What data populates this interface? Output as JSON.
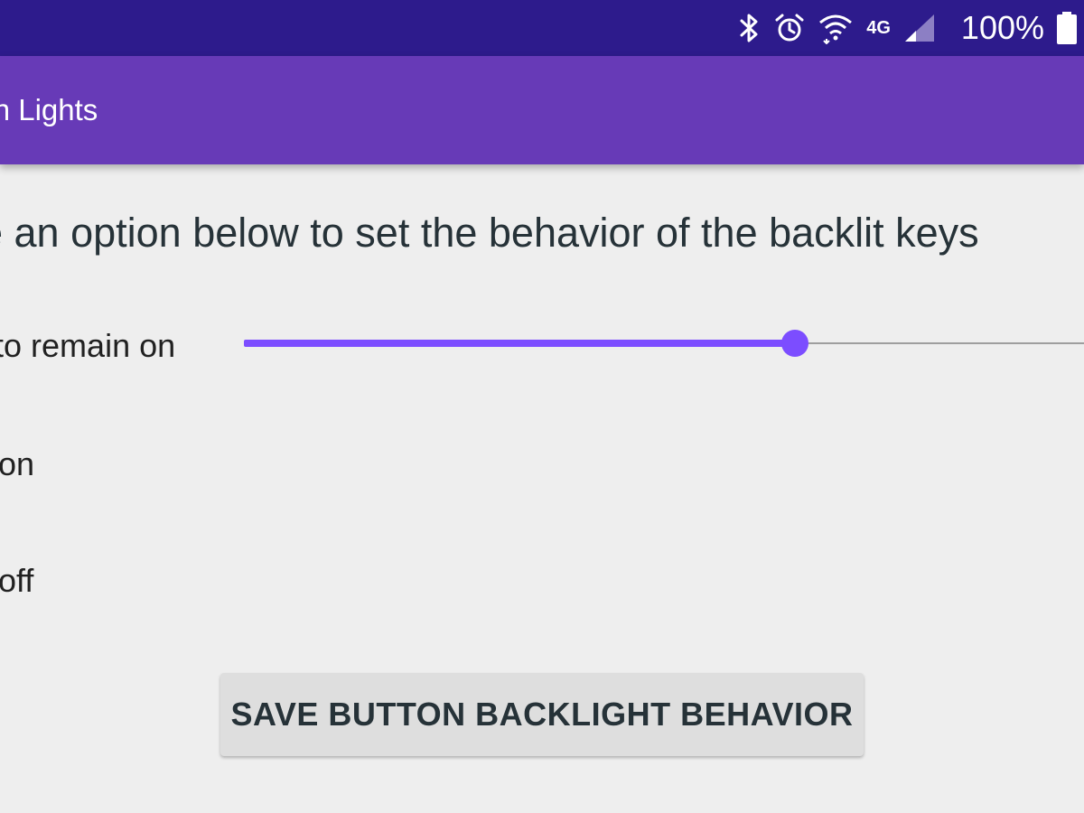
{
  "status_bar": {
    "battery_text": "100%",
    "network_label": "4G",
    "icons": [
      "bluetooth-icon",
      "alarm-icon",
      "wifi-icon",
      "signal-icon",
      "battery-icon"
    ],
    "background_color": "#2d1b8c"
  },
  "app_bar": {
    "title": "tton Lights",
    "background_color": "#673ab7"
  },
  "main": {
    "instruction": "e an option below to set the behavior of the backlit keys",
    "options": [
      {
        "label": "e to remain on"
      },
      {
        "label": "ys on"
      },
      {
        "label": "ys off"
      }
    ],
    "slider": {
      "value_fraction": 0.656,
      "accent_color": "#7c4dff"
    },
    "save_button_label": "SAVE BUTTON BACKLIGHT BEHAVIOR"
  }
}
